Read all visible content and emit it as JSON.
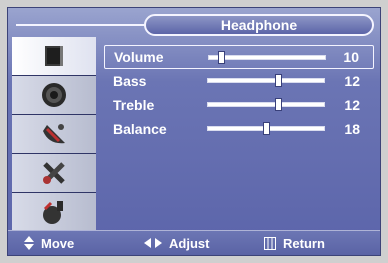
{
  "menu": {
    "title": "Headphone",
    "items": [
      {
        "label": "Volume",
        "value": "10",
        "level": 10,
        "max": 100,
        "selected": true
      },
      {
        "label": "Bass",
        "value": "12",
        "level": 12,
        "max": 20,
        "selected": false
      },
      {
        "label": "Treble",
        "value": "12",
        "level": 12,
        "max": 20,
        "selected": false
      },
      {
        "label": "Balance",
        "value": "18",
        "level": 18,
        "max": 36,
        "selected": false
      }
    ]
  },
  "sidebar": {
    "items": [
      {
        "icon": "picture-icon",
        "active": true
      },
      {
        "icon": "speaker-icon",
        "active": false
      },
      {
        "icon": "satellite-dish-icon",
        "active": false
      },
      {
        "icon": "settings-icon",
        "active": false
      },
      {
        "icon": "input-plug-icon",
        "active": false
      }
    ]
  },
  "footer": {
    "move_label": "Move",
    "adjust_label": "Adjust",
    "return_label": "Return"
  },
  "colors": {
    "panel": "#5b64aa",
    "text": "#ffffff",
    "highlight_border": "#f4f4ff"
  }
}
